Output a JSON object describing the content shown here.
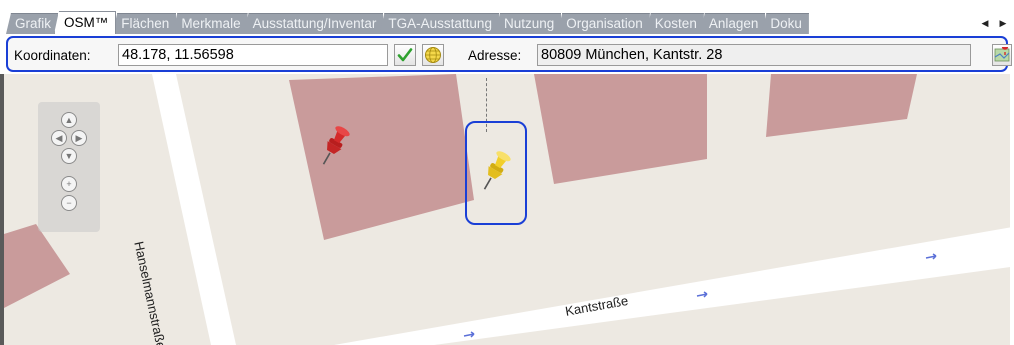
{
  "tabs": [
    {
      "label": "Grafik",
      "active": false
    },
    {
      "label": "OSM™",
      "active": true
    },
    {
      "label": "Flächen",
      "active": false
    },
    {
      "label": "Merkmale",
      "active": false
    },
    {
      "label": "Ausstattung/Inventar",
      "active": false
    },
    {
      "label": "TGA-Ausstattung",
      "active": false
    },
    {
      "label": "Nutzung",
      "active": false
    },
    {
      "label": "Organisation",
      "active": false
    },
    {
      "label": "Kosten",
      "active": false
    },
    {
      "label": "Anlagen",
      "active": false
    },
    {
      "label": "Doku",
      "active": false
    }
  ],
  "tab_scroll": {
    "left_icon": "triangle-left-icon",
    "right_icon": "triangle-right-icon"
  },
  "toolbar": {
    "coords_label": "Koordinaten:",
    "coords_value": "48.178, 11.56598",
    "confirm_icon": "checkmark-icon",
    "geocode_icon": "globe-icon",
    "address_label": "Adresse:",
    "address_value": "80809 München, Kantstr. 28",
    "map_icon": "map-marker-icon"
  },
  "map": {
    "streets": [
      "Hanselmannstraße",
      "Kantstraße"
    ],
    "colors": {
      "building": "#c99b9b",
      "ground": "#ede9e2",
      "road": "#ffffff",
      "selection": "#1a3fd6"
    },
    "pins": [
      {
        "name": "red-pin-icon",
        "color": "#d42a2a"
      },
      {
        "name": "yellow-pin-icon",
        "color": "#f2cf2a"
      }
    ]
  }
}
